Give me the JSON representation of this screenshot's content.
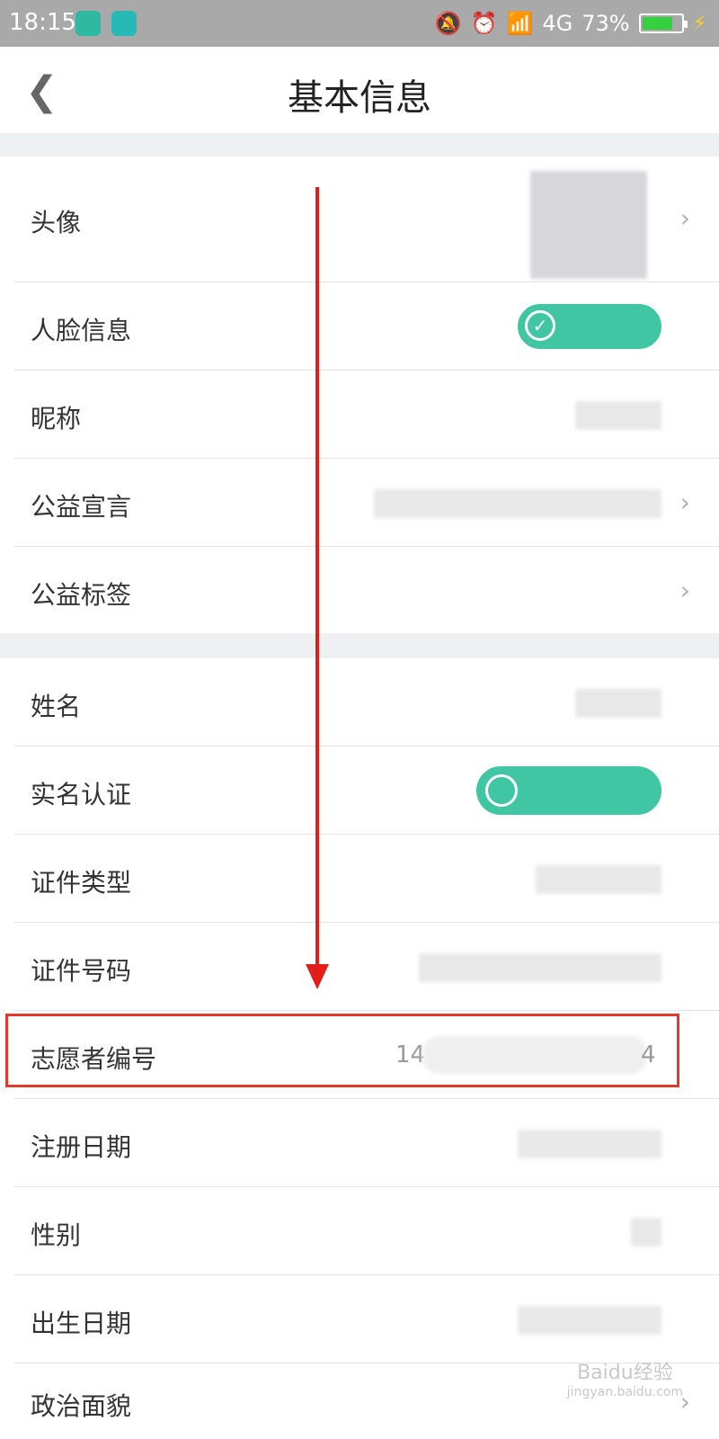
{
  "status_bar": {
    "time": "18:15",
    "network": "4G",
    "battery": "73%"
  },
  "nav": {
    "title": "基本信息",
    "back_icon": "chevron-left-icon"
  },
  "section1": [
    {
      "label": "头像"
    },
    {
      "label": "人脸信息"
    },
    {
      "label": "昵称"
    },
    {
      "label": "公益宣言"
    },
    {
      "label": "公益标签"
    }
  ],
  "section2": [
    {
      "label": "姓名"
    },
    {
      "label": "实名认证"
    },
    {
      "label": "证件类型"
    },
    {
      "label": "证件号码"
    },
    {
      "label": "志愿者编号",
      "value_start": "14",
      "value_end": "4"
    },
    {
      "label": "注册日期"
    },
    {
      "label": "性别"
    },
    {
      "label": "出生日期"
    },
    {
      "label": "政治面貌"
    }
  ],
  "watermark": {
    "line1": "Baidu经验",
    "line2": "jingyan.baidu.com"
  },
  "colors": {
    "accent_green": "#41c6a3",
    "highlight_red": "#e03a2f",
    "status_bar": "#a9a9a9"
  }
}
